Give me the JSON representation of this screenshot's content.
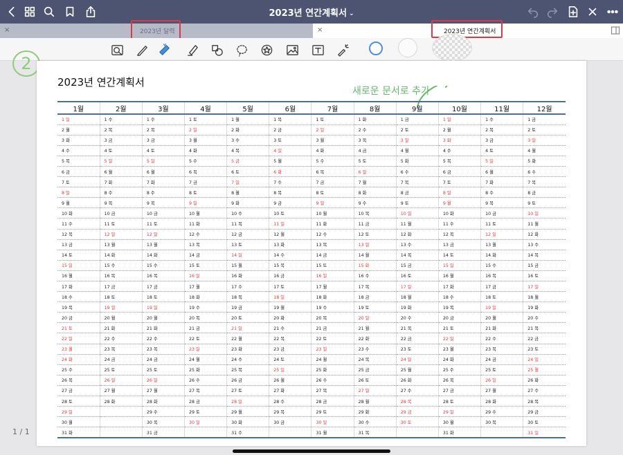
{
  "topbar": {
    "title": "2023년 연간계획서"
  },
  "tabs": [
    {
      "label": "2023년 달력",
      "active": false
    },
    {
      "label": "2023년 연간계획서",
      "active": true
    }
  ],
  "page": {
    "title": "2023년  연간계획서",
    "annotation_number": "2",
    "annotation_text": "새로운 문서로 추가",
    "months": [
      "1월",
      "2월",
      "3월",
      "4월",
      "5월",
      "6월",
      "7월",
      "8월",
      "9월",
      "10월",
      "11월",
      "12월"
    ],
    "weekdays": [
      "일",
      "월",
      "화",
      "수",
      "목",
      "금",
      "토"
    ],
    "month_first_weekday": [
      0,
      3,
      3,
      6,
      1,
      4,
      6,
      2,
      5,
      0,
      3,
      5
    ],
    "month_days": [
      31,
      28,
      31,
      30,
      31,
      30,
      31,
      31,
      30,
      31,
      30,
      31
    ],
    "holidays": [
      [
        "1-21",
        "1-22",
        "1-23",
        "1-24"
      ],
      [
        "3-1"
      ],
      [],
      [],
      [
        "5-5"
      ],
      [
        "6-6"
      ],
      [],
      [
        "8-15"
      ],
      [
        "9-28",
        "9-29",
        "9-30"
      ],
      [
        "10-3",
        "10-9"
      ],
      [],
      [
        "12-25"
      ]
    ]
  },
  "footer": {
    "page_count": "1 / 1"
  },
  "colors": {
    "topbar": "#4c5472",
    "holiday": "#e0383f",
    "rule": "#4a6f8d",
    "annotation": "#65b96a",
    "highlight_box": "#d83a4a"
  }
}
